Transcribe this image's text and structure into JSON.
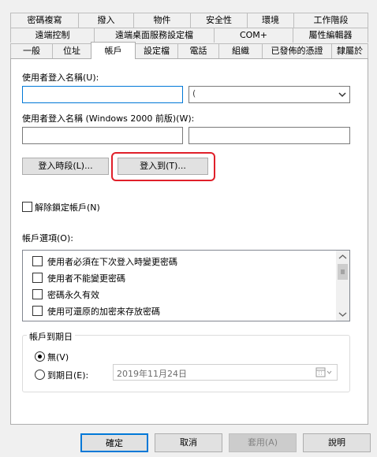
{
  "tabs": {
    "row1": [
      "密碼複寫",
      "撥入",
      "物件",
      "安全性",
      "環境",
      "工作階段"
    ],
    "row2": [
      "遠端控制",
      "遠端桌面服務設定檔",
      "COM+",
      "屬性編輯器"
    ],
    "row3": [
      "一般",
      "位址",
      "帳戶",
      "設定檔",
      "電話",
      "組織",
      "已發佈的憑證",
      "隸屬於"
    ],
    "active": "帳戶"
  },
  "logon": {
    "upn_label": "使用者登入名稱(U):",
    "upn_value": "",
    "upn_suffix_value": "(",
    "sam_label": "使用者登入名稱 (Windows 2000 前版)(W):",
    "domain_value": "",
    "sam_value": "",
    "logon_hours_button": "登入時段(L)...",
    "logon_to_button": "登入到(T)..."
  },
  "unlock": {
    "label": "解除鎖定帳戶(N)",
    "checked": false
  },
  "account_options": {
    "label": "帳戶選項(O):",
    "items": [
      {
        "label": "使用者必須在下次登入時變更密碼",
        "checked": false
      },
      {
        "label": "使用者不能變更密碼",
        "checked": false
      },
      {
        "label": "密碼永久有效",
        "checked": false
      },
      {
        "label": "使用可還原的加密來存放密碼",
        "checked": false
      }
    ]
  },
  "expires": {
    "title": "帳戶到期日",
    "never_label": "無(V)",
    "never_selected": true,
    "end_of_label": "到期日(E):",
    "end_of_selected": false,
    "date_value": "2019年11月24日"
  },
  "footer": {
    "ok": "確定",
    "cancel": "取消",
    "apply": "套用(A)",
    "help": "說明"
  },
  "colors": {
    "highlight": "#e0202a",
    "focus_border": "#0078d7"
  }
}
